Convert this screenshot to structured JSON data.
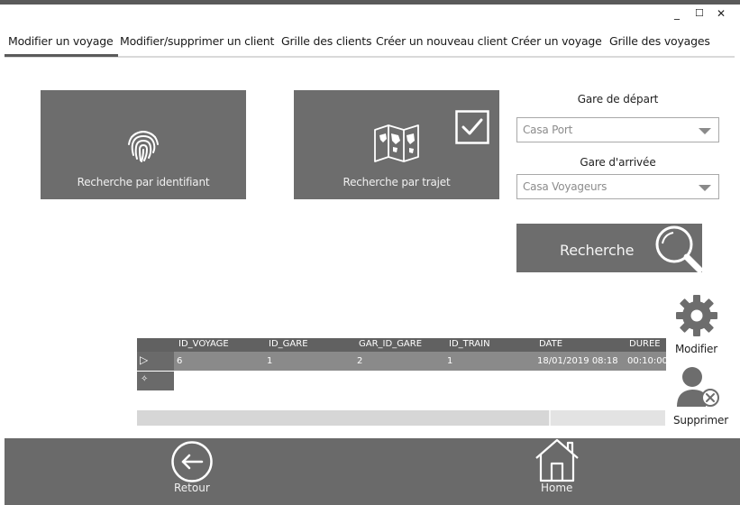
{
  "window": {
    "minimize_label": "_",
    "maximize_label": "☐",
    "close_label": "✕"
  },
  "tabs": [
    {
      "label": "Modifier un voyage",
      "active": true
    },
    {
      "label": "Modifier/supprimer un client"
    },
    {
      "label": "Grille des clients"
    },
    {
      "label": "Créer un nouveau client"
    },
    {
      "label": "Créer un voyage"
    },
    {
      "label": "Grille des voyages"
    }
  ],
  "tiles": {
    "by_id": {
      "label": "Recherche par identifiant",
      "icon": "fingerprint-icon"
    },
    "by_route": {
      "label": "Recherche par  trajet",
      "icon": "map-icon",
      "checked": true
    }
  },
  "form": {
    "departure_label": "Gare de départ",
    "departure_value": "Casa Port",
    "arrival_label": "Gare d'arrivée",
    "arrival_value": "Casa Voyageurs",
    "search_label": "Recherche"
  },
  "grid": {
    "columns": [
      "ID_VOYAGE",
      "ID_GARE",
      "GAR_ID_GARE",
      "ID_TRAIN",
      "DATE",
      "DUREE"
    ],
    "rows": [
      [
        "6",
        "1",
        "2",
        "1",
        "18/01/2019 08:18",
        "00:10:00"
      ]
    ],
    "current_row_marker": "▷",
    "new_row_marker": "✧"
  },
  "actions": {
    "modify_label": "Modifier",
    "delete_label": "Supprimer"
  },
  "footer": {
    "back_label": "Retour",
    "home_label": "Home"
  },
  "colors": {
    "tile": "#6d6d6d",
    "footer": "#6a6a6a",
    "grid_header": "#616161",
    "grid_row": "#8a8a8a",
    "icon_gray": "#6d6d6d"
  }
}
